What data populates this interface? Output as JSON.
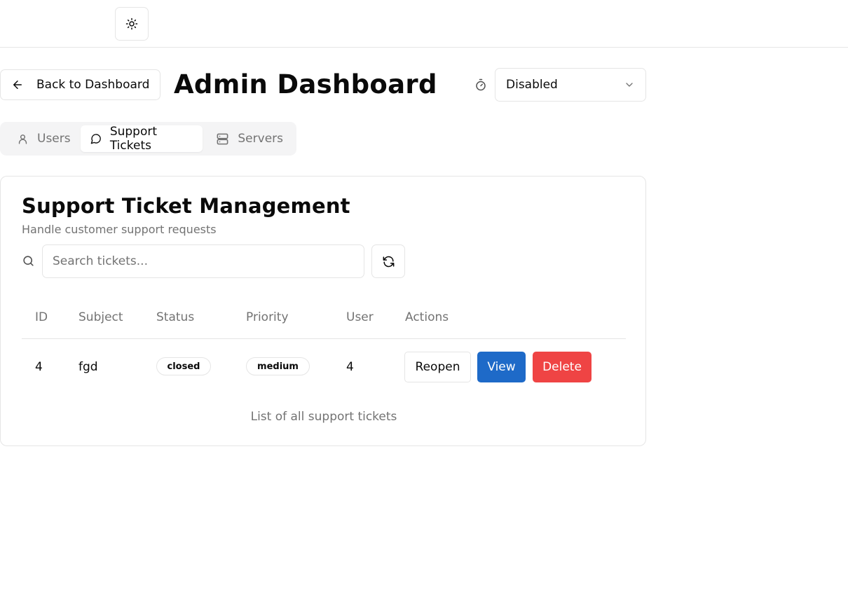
{
  "header": {
    "theme_toggle_icon": "sun-icon"
  },
  "nav": {
    "back_label": "Back to Dashboard",
    "page_title": "Admin Dashboard",
    "timer_select": {
      "icon": "timer-icon",
      "selected": "Disabled"
    }
  },
  "tabs": [
    {
      "label": "Users",
      "icon": "user-icon",
      "active": false
    },
    {
      "label": "Support Tickets",
      "icon": "message-circle-icon",
      "active": true
    },
    {
      "label": "Servers",
      "icon": "server-icon",
      "active": false
    }
  ],
  "card": {
    "title": "Support Ticket Management",
    "subtitle": "Handle customer support requests",
    "search": {
      "placeholder": "Search tickets...",
      "value": ""
    },
    "table": {
      "columns": [
        "ID",
        "Subject",
        "Status",
        "Priority",
        "User",
        "Actions"
      ],
      "rows": [
        {
          "id": "4",
          "subject": "fgd",
          "status": "closed",
          "priority": "medium",
          "user": "4",
          "actions": {
            "reopen": "Reopen",
            "view": "View",
            "delete": "Delete"
          }
        }
      ],
      "caption": "List of all support tickets"
    }
  },
  "colors": {
    "primary": "#1e6ac8",
    "danger": "#ef4444",
    "border": "#e5e5e5",
    "muted_text": "#737373"
  }
}
